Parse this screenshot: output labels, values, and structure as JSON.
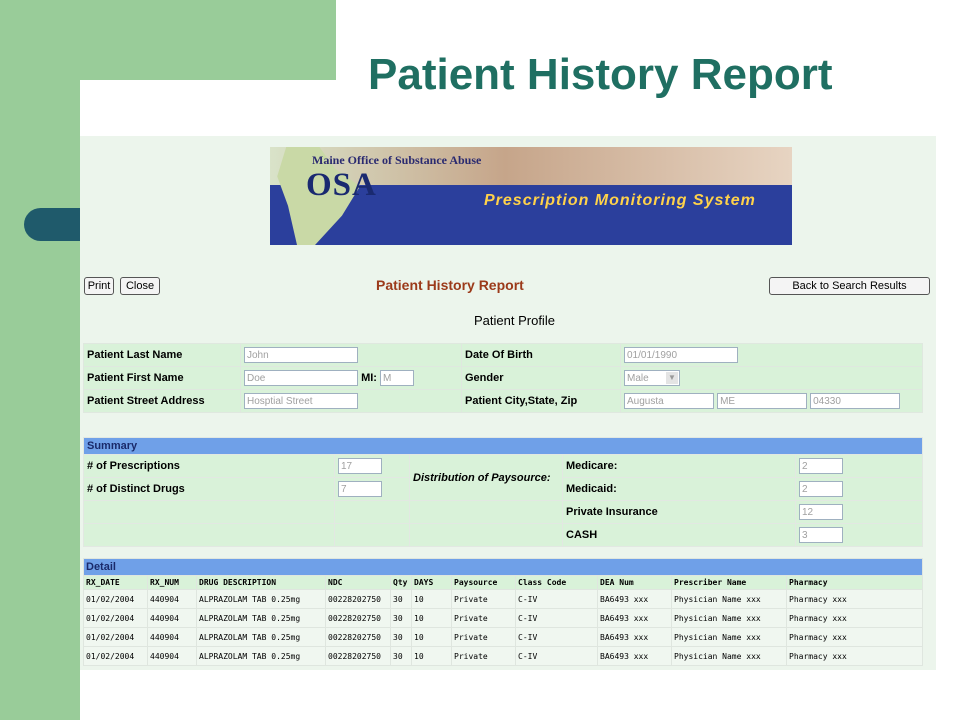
{
  "slide": {
    "title": "Patient History Report"
  },
  "banner": {
    "org": "Maine Office of Substance Abuse",
    "acronym": "OSA",
    "system": "Prescription Monitoring System"
  },
  "toolbar": {
    "print_label": "Print",
    "close_label": "Close",
    "back_label": "Back to Search Results"
  },
  "report": {
    "heading": "Patient History Report",
    "profile_heading": "Patient Profile"
  },
  "profile": {
    "last_name_label": "Patient Last Name",
    "last_name": "John",
    "dob_label": "Date Of Birth",
    "dob": "01/01/1990",
    "first_name_label": "Patient First Name",
    "first_name": "Doe",
    "mi_label": "MI:",
    "mi": "M",
    "gender_label": "Gender",
    "gender": "Male",
    "street_label": "Patient Street Address",
    "street": "Hosptial Street",
    "csz_label": "Patient City,State, Zip",
    "city": "Augusta",
    "state": "ME",
    "zip": "04330"
  },
  "summary": {
    "header": "Summary",
    "prescriptions_label": "# of Prescriptions",
    "prescriptions": "17",
    "distinct_label": "# of Distinct Drugs",
    "distinct": "7",
    "distribution_label": "Distribution of Paysource:",
    "medicare_label": "Medicare:",
    "medicare": "2",
    "medicaid_label": "Medicaid:",
    "medicaid": "2",
    "private_label": "Private Insurance",
    "private": "12",
    "cash_label": "CASH",
    "cash": "3"
  },
  "detail": {
    "header": "Detail",
    "columns": [
      "RX_DATE",
      "RX_NUM",
      "DRUG DESCRIPTION",
      "NDC",
      "Qty",
      "DAYS",
      "Paysource",
      "Class Code",
      "DEA Num",
      "Prescriber Name",
      "Pharmacy"
    ],
    "rows": [
      [
        "01/02/2004",
        "440904",
        "ALPRAZOLAM TAB 0.25mg",
        "00228202750",
        "30",
        "10",
        "Private",
        "C-IV",
        "BA6493 xxx",
        "Physician Name xxx",
        "Pharmacy xxx"
      ],
      [
        "01/02/2004",
        "440904",
        "ALPRAZOLAM TAB 0.25mg",
        "00228202750",
        "30",
        "10",
        "Private",
        "C-IV",
        "BA6493 xxx",
        "Physician Name xxx",
        "Pharmacy xxx"
      ],
      [
        "01/02/2004",
        "440904",
        "ALPRAZOLAM TAB 0.25mg",
        "00228202750",
        "30",
        "10",
        "Private",
        "C-IV",
        "BA6493 xxx",
        "Physician Name xxx",
        "Pharmacy xxx"
      ],
      [
        "01/02/2004",
        "440904",
        "ALPRAZOLAM TAB 0.25mg",
        "00228202750",
        "30",
        "10",
        "Private",
        "C-IV",
        "BA6493 xxx",
        "Physician Name xxx",
        "Pharmacy xxx"
      ]
    ]
  }
}
